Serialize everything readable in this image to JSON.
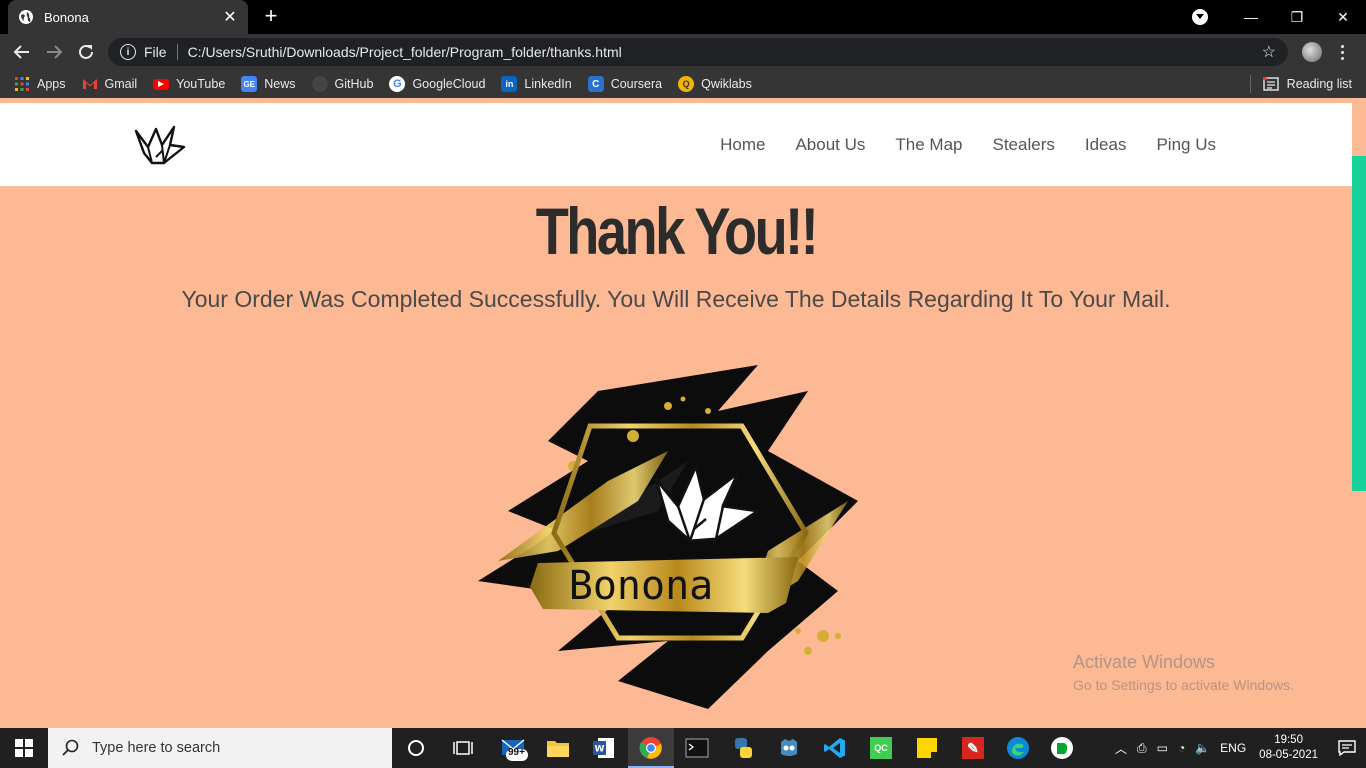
{
  "browser": {
    "tab_title": "Bonona",
    "address_prefix": "File",
    "url": "C:/Users/Sruthi/Downloads/Project_folder/Program_folder/thanks.html",
    "bookmarks": [
      {
        "label": "Apps",
        "icon": "apps-grid-icon",
        "color": "#ea4335"
      },
      {
        "label": "Gmail",
        "icon": "gmail-icon",
        "color": "#ea4335"
      },
      {
        "label": "YouTube",
        "icon": "youtube-icon",
        "color": "#ff0000"
      },
      {
        "label": "News",
        "icon": "google-news-icon",
        "color": "#4285f4"
      },
      {
        "label": "GitHub",
        "icon": "github-icon",
        "color": "#444444"
      },
      {
        "label": "GoogleCloud",
        "icon": "google-icon",
        "color": "#ffffff"
      },
      {
        "label": "LinkedIn",
        "icon": "linkedin-icon",
        "color": "#0a66c2"
      },
      {
        "label": "Coursera",
        "icon": "coursera-icon",
        "color": "#2a73cc"
      },
      {
        "label": "Qwiklabs",
        "icon": "qwiklabs-icon",
        "color": "#f4b400"
      }
    ],
    "reading_list": "Reading list"
  },
  "site": {
    "nav": [
      "Home",
      "About Us",
      "The Map",
      "Stealers",
      "Ideas",
      "Ping Us"
    ],
    "heading": "Thank You!!",
    "message": "Your Order Was Completed Successfully. You Will Receive The Details Regarding It To Your Mail.",
    "brand_name": "Bonona",
    "colors": {
      "background": "#fdb894",
      "accent_scrollbar": "#17d39b",
      "gold": "#c9a227"
    }
  },
  "watermark": {
    "line1": "Activate Windows",
    "line2": "Go to Settings to activate Windows."
  },
  "taskbar": {
    "search_placeholder": "Type here to search",
    "mail_badge": "99+",
    "language": "ENG",
    "time": "19:50",
    "date": "08-05-2021"
  }
}
